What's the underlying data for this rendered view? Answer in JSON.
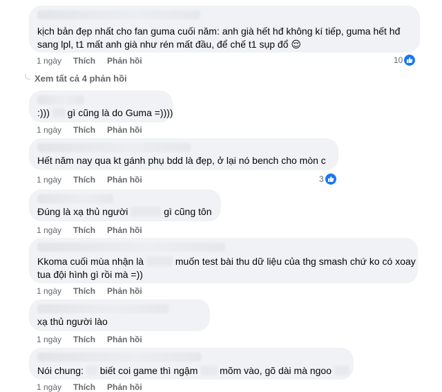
{
  "accent_color": "#1877f2",
  "comments": [
    {
      "text_lines": [
        "kịch bản đẹp nhất cho fan guma cuối năm: anh già hết hđ không kí tiếp, guma hết hđ",
        "sang lpl, t1 mất anh già như rén mất đầu, để chế t1 sụp đổ 😌"
      ],
      "time": "1 ngày",
      "like_label": "Thích",
      "reply_label": "Phản hồi",
      "reactions": "10"
    },
    {
      "text_parts": [
        ":)))",
        "gì cũng là do Guma =))))"
      ],
      "time": "1 ngày",
      "like_label": "Thích",
      "reply_label": "Phản hồi"
    },
    {
      "text_parts": [
        "Hết năm nay qua kt gánh phụ bdd là đẹp, ở lại nó bench cho mòn c"
      ],
      "time": "1 ngày",
      "like_label": "Thích",
      "reply_label": "Phản hồi",
      "reactions": "3"
    },
    {
      "text_parts": [
        "Đúng là xạ thủ người",
        "gì cũng tôn"
      ],
      "time": "1 ngày",
      "like_label": "Thích",
      "reply_label": "Phản hồi"
    },
    {
      "text_parts": [
        "Kkoma cuối mùa nhận là",
        "muốn test bài thu dữ liệu của thg smash chứ ko có xoay"
      ],
      "text_line2": "tua đội hình gì rồi mà =))",
      "time": "1 ngày",
      "like_label": "Thích",
      "reply_label": "Phản hồi"
    },
    {
      "text_parts": [
        "xạ thủ người lào"
      ],
      "time": "1 ngày",
      "like_label": "Thích",
      "reply_label": "Phản hồi"
    },
    {
      "text_parts": [
        "Nói chung:",
        "biết coi game thì ngậm",
        "mõm vào, gõ dài mà ngoo"
      ],
      "time": "1 ngày",
      "like_label": "Thích",
      "reply_label": "Phản hồi"
    }
  ],
  "see_all_replies": "Xem tất cả 4 phản hồi",
  "icons": {
    "like": "thumbs-up-icon"
  }
}
